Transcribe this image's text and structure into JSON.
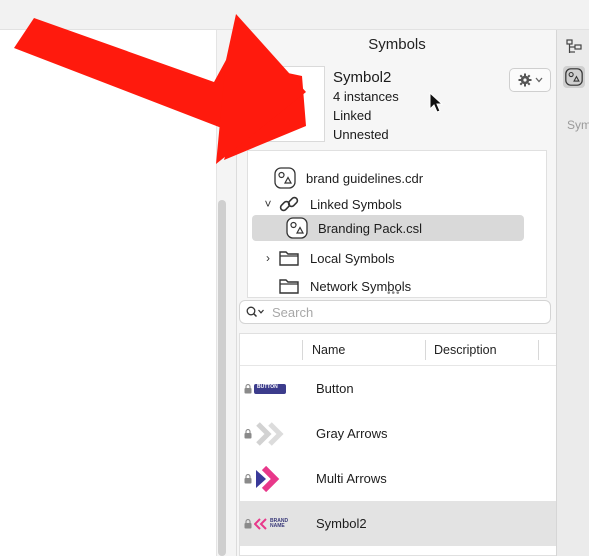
{
  "panel": {
    "title": "Symbols"
  },
  "symbol": {
    "name": "Symbol2",
    "instances": "4 instances",
    "link_state": "Linked",
    "nesting": "Unnested"
  },
  "tree": {
    "items": [
      {
        "label": "brand guidelines.cdr",
        "icon": "symbol-file-icon",
        "chevron": ""
      },
      {
        "label": "Linked Symbols",
        "icon": "link-icon",
        "chevron": "˅"
      },
      {
        "label": "Branding Pack.csl",
        "icon": "symbol-file-icon",
        "chevron": "",
        "selected": true
      },
      {
        "label": "Local Symbols",
        "icon": "folder-icon",
        "chevron": "›"
      },
      {
        "label": "Network Symbols",
        "icon": "folder-icon",
        "chevron": ""
      }
    ]
  },
  "search": {
    "placeholder": "Search"
  },
  "table": {
    "columns": [
      "Name",
      "Description"
    ],
    "rows": [
      {
        "name": "Button",
        "thumb_text": "BUTTON"
      },
      {
        "name": "Gray Arrows"
      },
      {
        "name": "Multi Arrows"
      },
      {
        "name": "Symbol2",
        "thumb_text": "BRAND NAME",
        "selected": true
      }
    ]
  },
  "right_strip": {
    "truncated_label": "Sym"
  },
  "colors": {
    "annotation_arrow": "#ff1a0d",
    "button_thumb": "#3c3c8c",
    "multi_arrow_pink": "#e8388a",
    "multi_arrow_blue": "#3a3a9a",
    "gray_arrow": "#d2d2d2"
  }
}
